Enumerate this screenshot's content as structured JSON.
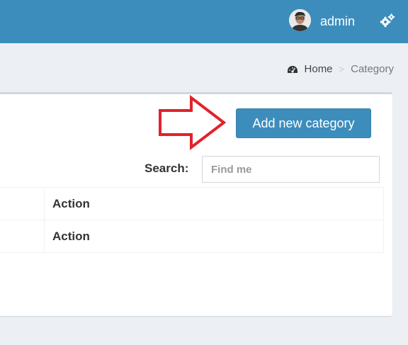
{
  "header": {
    "username": "admin",
    "accent_color": "#3c8dbc",
    "avatar_icon": "user-avatar",
    "settings_icon": "gears-icon"
  },
  "breadcrumb": {
    "icon": "dashboard-icon",
    "home": "Home",
    "separator": ">",
    "current": "Category"
  },
  "main": {
    "add_button_label": "Add new category",
    "annotation_arrow_color": "#e0232b",
    "search": {
      "label": "Search:",
      "placeholder": "Find me",
      "value": ""
    },
    "table": {
      "header_action": "Action",
      "footer_action": "Action"
    }
  }
}
